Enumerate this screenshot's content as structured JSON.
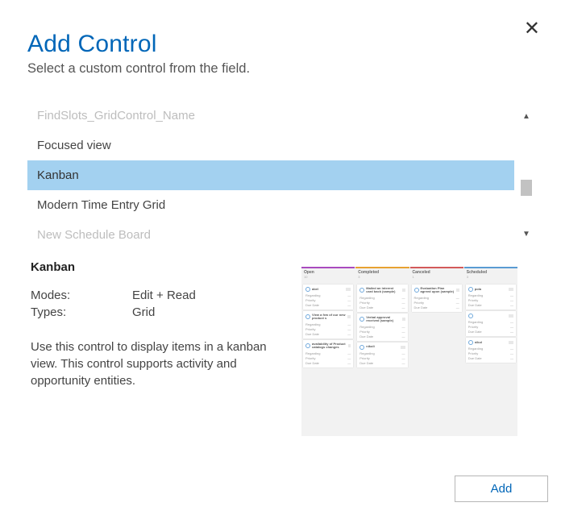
{
  "close_label": "✕",
  "header": {
    "title": "Add Control",
    "subtitle": "Select a custom control from the field."
  },
  "list": {
    "items": [
      {
        "label": "FindSlots_GridControl_Name",
        "dim": true
      },
      {
        "label": "Focused view"
      },
      {
        "label": "Kanban",
        "selected": true
      },
      {
        "label": "Modern Time Entry Grid"
      },
      {
        "label": "New Schedule Board",
        "dim": true
      }
    ]
  },
  "details": {
    "title": "Kanban",
    "modes_label": "Modes:",
    "modes_value": "Edit + Read",
    "types_label": "Types:",
    "types_value": "Grid",
    "description": "Use this control to display items in a kanban view. This control supports activity and opportunity entities."
  },
  "preview": {
    "columns": [
      {
        "name": "Open",
        "count": "10",
        "cards": [
          "abel",
          "View a few of our new product s",
          "availability of Product catalogs changes"
        ]
      },
      {
        "name": "Completed",
        "count": "3",
        "cards": [
          "Mailed an interest card back (sample)",
          "Verbal approval received (sample)",
          "nikoli"
        ]
      },
      {
        "name": "Canceled",
        "count": "1",
        "cards": [
          "Evaluation Plan agreed upon (sample)"
        ]
      },
      {
        "name": "Scheduled",
        "count": "3",
        "cards": [
          "pola",
          "",
          "nikol"
        ]
      }
    ],
    "card_rows": [
      "Regarding",
      "Priority",
      "Due Date"
    ]
  },
  "footer": {
    "add": "Add"
  }
}
